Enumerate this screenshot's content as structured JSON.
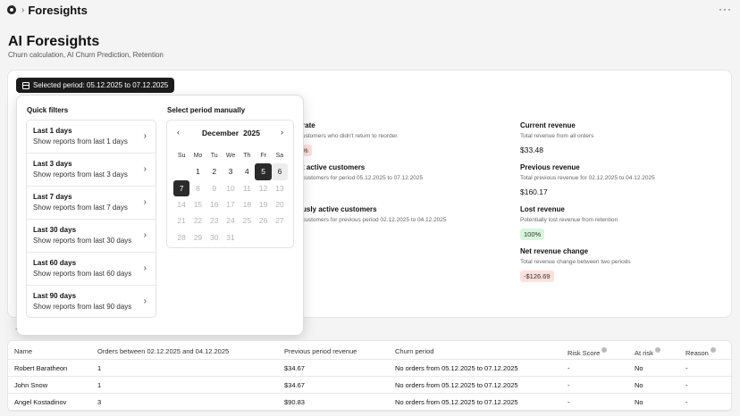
{
  "header": {
    "breadcrumb_sep": "›",
    "title": "Foresights",
    "more_label": "···"
  },
  "page": {
    "title": "AI Foresights",
    "subtitle": "Churn calculation, AI Churn Prediction, Retention"
  },
  "period_button": {
    "label": "Selected period: 05.12.2025 to 07.12.2025"
  },
  "stats": {
    "churn_rate": {
      "label": "rate",
      "desc": "ustomers who didn't return to reorder.",
      "badge": "%"
    },
    "current_active": {
      "label": "t active customers",
      "desc": "customers for period 05.12.2025 to 07.12.2025"
    },
    "previous_active": {
      "label": "usly active customers",
      "desc": "customers for previous period 02.12.2025 to 04.12.2025"
    },
    "current_revenue": {
      "label": "Current revenue",
      "desc": "Total revenue from all orders",
      "value": "$33.48"
    },
    "previous_revenue": {
      "label": "Previous revenue",
      "desc": "Total previous revenue for 02.12.2025 to 04.12.2025",
      "value": "$160.17"
    },
    "lost_revenue": {
      "label": "Lost revenue",
      "desc": "Potentially lost revenue from retention",
      "badge": "100%"
    },
    "net_revenue": {
      "label": "Net revenue change",
      "desc": "Total revenue change between two periods",
      "badge": "-$126.69"
    }
  },
  "popover": {
    "quick_filters_title": "Quick filters",
    "quick_filters": [
      {
        "title": "Last 1 days",
        "subtitle": "Show reports from last 1 days"
      },
      {
        "title": "Last 3 days",
        "subtitle": "Show reports from last 3 days"
      },
      {
        "title": "Last 7 days",
        "subtitle": "Show reports from last 7 days"
      },
      {
        "title": "Last 30 days",
        "subtitle": "Show reports from last 30 days"
      },
      {
        "title": "Last 60 days",
        "subtitle": "Show reports from last 60 days"
      },
      {
        "title": "Last 90 days",
        "subtitle": "Show reports from last 90 days"
      }
    ],
    "manual_title": "Select period manually",
    "calendar": {
      "month": "December",
      "year": "2025",
      "weekdays": [
        "Su",
        "Mo",
        "Tu",
        "We",
        "Th",
        "Fr",
        "Sa"
      ],
      "days": [
        {
          "d": "",
          "s": "empty"
        },
        {
          "d": "1",
          "s": ""
        },
        {
          "d": "2",
          "s": ""
        },
        {
          "d": "3",
          "s": ""
        },
        {
          "d": "4",
          "s": ""
        },
        {
          "d": "5",
          "s": "sel"
        },
        {
          "d": "6",
          "s": "range"
        },
        {
          "d": "7",
          "s": "sel"
        },
        {
          "d": "8",
          "s": "dim"
        },
        {
          "d": "9",
          "s": "dim"
        },
        {
          "d": "10",
          "s": "dim"
        },
        {
          "d": "11",
          "s": "dim"
        },
        {
          "d": "12",
          "s": "dim"
        },
        {
          "d": "13",
          "s": "dim"
        },
        {
          "d": "14",
          "s": "dim"
        },
        {
          "d": "15",
          "s": "dim"
        },
        {
          "d": "16",
          "s": "dim"
        },
        {
          "d": "17",
          "s": "dim"
        },
        {
          "d": "18",
          "s": "dim"
        },
        {
          "d": "19",
          "s": "dim"
        },
        {
          "d": "20",
          "s": "dim"
        },
        {
          "d": "21",
          "s": "dim"
        },
        {
          "d": "22",
          "s": "dim"
        },
        {
          "d": "23",
          "s": "dim"
        },
        {
          "d": "24",
          "s": "dim"
        },
        {
          "d": "25",
          "s": "dim"
        },
        {
          "d": "26",
          "s": "dim"
        },
        {
          "d": "27",
          "s": "dim"
        },
        {
          "d": "28",
          "s": "dim"
        },
        {
          "d": "29",
          "s": "dim"
        },
        {
          "d": "30",
          "s": "dim"
        },
        {
          "d": "31",
          "s": "dim"
        }
      ]
    }
  },
  "table": {
    "headers": [
      "Name",
      "Orders between 02.12.2025 and 04.12.2025",
      "Previous period revenue",
      "Churn period",
      "Risk Score",
      "At risk",
      "Reason"
    ],
    "rows": [
      [
        "Robert Baratheon",
        "1",
        "$34.67",
        "No orders from 05.12.2025 to 07.12.2025",
        "-",
        "No",
        "-"
      ],
      [
        "John Snow",
        "1",
        "$34.67",
        "No orders from 05.12.2025 to 07.12.2025",
        "-",
        "No",
        "-"
      ],
      [
        "Angel Kostadinov",
        "3",
        "$90.83",
        "No orders from 05.12.2025 to 07.12.2025",
        "-",
        "No",
        "-"
      ]
    ]
  },
  "colors": {
    "dark_button": "#1c1c1c",
    "badge_red_bg": "#fde0dc",
    "badge_green_bg": "#d9f5dd"
  }
}
